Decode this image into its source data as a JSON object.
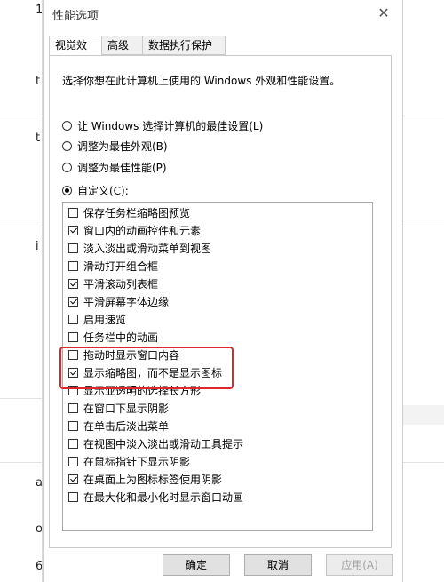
{
  "window": {
    "title": "性能选项",
    "close_glyph": "✕"
  },
  "tabs": [
    {
      "label": "视觉效果",
      "active": true
    },
    {
      "label": "高级",
      "active": false
    },
    {
      "label": "数据执行保护",
      "active": false
    }
  ],
  "description": "选择你想在此计算机上使用的 Windows 外观和性能设置。",
  "radio_options": [
    {
      "label": "让 Windows 选择计算机的最佳设置(L)",
      "selected": false
    },
    {
      "label": "调整为最佳外观(B)",
      "selected": false
    },
    {
      "label": "调整为最佳性能(P)",
      "selected": false
    },
    {
      "label": "自定义(C):",
      "selected": true
    }
  ],
  "checkbox_items": [
    {
      "label": "保存任务栏缩略图预览",
      "checked": false
    },
    {
      "label": "窗口内的动画控件和元素",
      "checked": true
    },
    {
      "label": "淡入淡出或滑动菜单到视图",
      "checked": false
    },
    {
      "label": "滑动打开组合框",
      "checked": false
    },
    {
      "label": "平滑滚动列表框",
      "checked": true
    },
    {
      "label": "平滑屏幕字体边缘",
      "checked": true
    },
    {
      "label": "启用速览",
      "checked": false
    },
    {
      "label": "任务栏中的动画",
      "checked": false
    },
    {
      "label": "拖动时显示窗口内容",
      "checked": false
    },
    {
      "label": "显示缩略图，而不是显示图标",
      "checked": true
    },
    {
      "label": "显示亚透明的选择长方形",
      "checked": false
    },
    {
      "label": "在窗口下显示阴影",
      "checked": false
    },
    {
      "label": "在单击后淡出菜单",
      "checked": false
    },
    {
      "label": "在视图中淡入淡出或滑动工具提示",
      "checked": false
    },
    {
      "label": "在鼠标指针下显示阴影",
      "checked": false
    },
    {
      "label": "在桌面上为图标标签使用阴影",
      "checked": true
    },
    {
      "label": "在最大化和最小化时显示窗口动画",
      "checked": false
    }
  ],
  "buttons": {
    "ok": "确定",
    "cancel": "取消",
    "apply": "应用(A)"
  },
  "background_left_chars": [
    "1",
    "t",
    "t",
    "i",
    "a",
    "o",
    "6"
  ],
  "colors": {
    "highlight": "#e0262d"
  }
}
